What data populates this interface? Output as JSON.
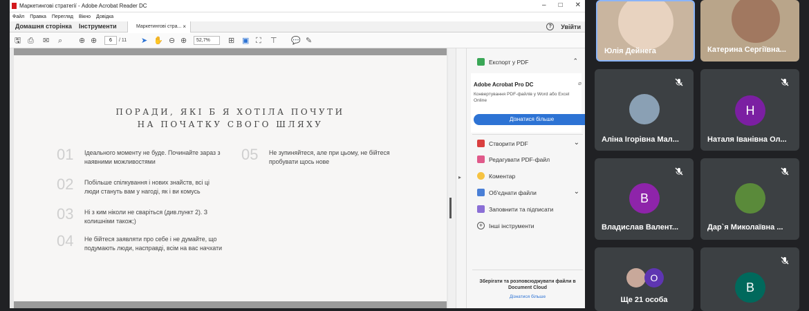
{
  "window": {
    "title": "Маркетингові стратегії - Adobe Acrobat Reader DC",
    "minimize": "–",
    "maximize": "□",
    "close": "✕"
  },
  "menu": [
    "Файл",
    "Правка",
    "Перегляд",
    "Вікно",
    "Довідка"
  ],
  "tabs": {
    "home": "Домашня сторінка",
    "tools": "Інструменти",
    "doc": "Маркетингові стра...",
    "doc_close": "×",
    "help": "?",
    "signin": "Увійти"
  },
  "toolbar": {
    "page_current": "6",
    "page_total": "/ 11",
    "zoom": "52,7%"
  },
  "document": {
    "heading_line1": "ПОРАДИ, ЯКІ Б Я ХОТІЛА ПОЧУТИ",
    "heading_line2": "НА ПОЧАТКУ СВОГО ШЛЯХУ",
    "tips": [
      {
        "num": "01",
        "text": "Ідеального моменту не буде. Починайте зараз з наявними можливостями"
      },
      {
        "num": "02",
        "text": "Побільше спілкування і нових знайств, всі ці люди стануть вам у нагоді, як і ви комусь"
      },
      {
        "num": "03",
        "text": "Ні з ким ніколи не сваріться (див.пункт 2). З колишніми також;)"
      },
      {
        "num": "04",
        "text": "Не бійтеся заявляти про себе і не думайте, що подумають люди, насправді, всім на вас начхати"
      },
      {
        "num": "05",
        "text": "Не зупиняйтеся, але при цьому, не бійтеся пробувати щось нове"
      }
    ]
  },
  "right_panel": {
    "export": "Експорт у PDF",
    "promo_title": "Adobe Acrobat Pro DC",
    "promo_desc": "Конвертування PDF-файлів у Word або Excel Online",
    "promo_button": "Дізнатися більше",
    "tools": [
      "Створити PDF",
      "Редагувати PDF-файл",
      "Коментар",
      "Об'єднати файли",
      "Заповнити та підписати",
      "Інші інструменти"
    ],
    "cloud_text": "Зберігати та розповсюджувати файли в Document Cloud",
    "cloud_link": "Дізнатися більше"
  },
  "participants": [
    {
      "name": "Юлія Дейнега"
    },
    {
      "name": "Катерина Сергіївна..."
    },
    {
      "name": "Аліна Ігорівна Мал...",
      "avatar": "photo"
    },
    {
      "name": "Наталя Іванівна Ол...",
      "initial": "Н",
      "color": "#7b1fa2"
    },
    {
      "name": "Владислав Валент...",
      "initial": "В",
      "color": "#8e24aa"
    },
    {
      "name": "Дар`я Миколаївна ...",
      "avatar": "photo"
    },
    {
      "name": "Ще 21 особа",
      "initial": "О",
      "color": "#5e35b1"
    },
    {
      "name": "",
      "initial": "В",
      "color": "#00695c"
    }
  ]
}
